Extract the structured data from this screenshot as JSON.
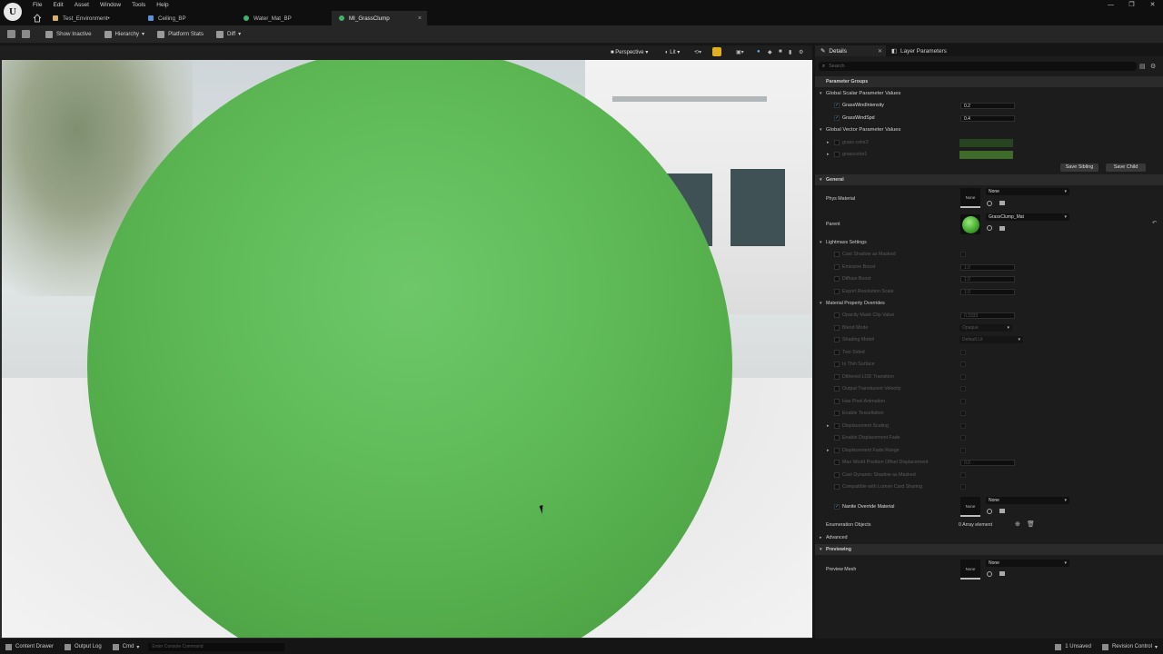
{
  "menu": [
    "File",
    "Edit",
    "Asset",
    "Window",
    "Tools",
    "Help"
  ],
  "tabs": [
    {
      "label": "Test_Environment•",
      "color": "#d7b16a",
      "active": false
    },
    {
      "label": "Ceiling_BP",
      "color": "#5f8fd8",
      "active": false
    },
    {
      "label": "Water_Mat_BP",
      "color": "#3fb36a",
      "active": false
    },
    {
      "label": "MI_GrassClump",
      "color": "#3fb36a",
      "active": true
    }
  ],
  "toolbar": {
    "show_inactive": "Show Inactive",
    "hierarchy": "Hierarchy",
    "platform_stats": "Platform Stats",
    "diff": "Diff"
  },
  "viewport": {
    "perspective": "Perspective",
    "lit": "Lit"
  },
  "panel": {
    "details_tab": "Details",
    "layer_tab": "Layer Parameters",
    "search_placeholder": "Search",
    "parameter_groups": "Parameter Groups",
    "global_scalar": "Global Scalar Parameter Values",
    "scalar_params": [
      {
        "name": "GrassWindIntensity",
        "value": "0.2"
      },
      {
        "name": "GrassWindSpd",
        "value": "0.4"
      }
    ],
    "global_vector": "Global Vector Parameter Values",
    "vector_params": [
      {
        "name": "grass color2",
        "color": "#27431f"
      },
      {
        "name": "grasscolor1",
        "color": "#3e6b2a"
      }
    ],
    "save_sibling": "Save Sibling",
    "save_child": "Save Child",
    "general": "General",
    "phys_material": "Phys Material",
    "phys_value": "None",
    "parent": "Parent",
    "parent_value": "GrassClump_Mat",
    "thumb_none": "None",
    "lightmass": "Lightmass Settings",
    "lightmass_rows": [
      {
        "name": "Cast Shadow as Masked",
        "value": ""
      },
      {
        "name": "Emissive Boost",
        "value": "1.0"
      },
      {
        "name": "Diffuse Boost",
        "value": "1.0"
      },
      {
        "name": "Export Resolution Scale",
        "value": "1.0"
      }
    ],
    "overrides": "Material Property Overrides",
    "override_rows": [
      {
        "name": "Opacity Mask Clip Value",
        "value": "0.3333"
      },
      {
        "name": "Blend Mode",
        "value": "Opaque"
      },
      {
        "name": "Shading Model",
        "value": "Default Lit"
      },
      {
        "name": "Two Sided",
        "value": ""
      },
      {
        "name": "Is Thin Surface",
        "value": ""
      },
      {
        "name": "Dithered LOD Transition",
        "value": ""
      },
      {
        "name": "Output Translucent Velocity",
        "value": ""
      },
      {
        "name": "Has Pixel Animation",
        "value": ""
      },
      {
        "name": "Enable Tessellation",
        "value": ""
      },
      {
        "name": "Displacement Scaling",
        "value": ""
      },
      {
        "name": "Enable Displacement Fade",
        "value": ""
      },
      {
        "name": "Displacement Fade Range",
        "value": ""
      },
      {
        "name": "Max World Position Offset Displacement",
        "value": "0.0"
      },
      {
        "name": "Cast Dynamic Shadow as Masked",
        "value": ""
      },
      {
        "name": "Compatible with Lumen Card Sharing",
        "value": ""
      }
    ],
    "nanite_override": "Nanite Override Material",
    "nanite_value": "None",
    "enum_objects": "Enumeration Objects",
    "enum_value": "0 Array element",
    "advanced": "Advanced",
    "previewing": "Previewing",
    "preview_mesh": "Preview Mesh",
    "preview_value": "None"
  },
  "status": {
    "content_drawer": "Content Drawer",
    "output_log": "Output Log",
    "cmd": "Cmd",
    "console_placeholder": "Enter Console Command",
    "unsaved": "1 Unsaved",
    "revision": "Revision Control"
  }
}
